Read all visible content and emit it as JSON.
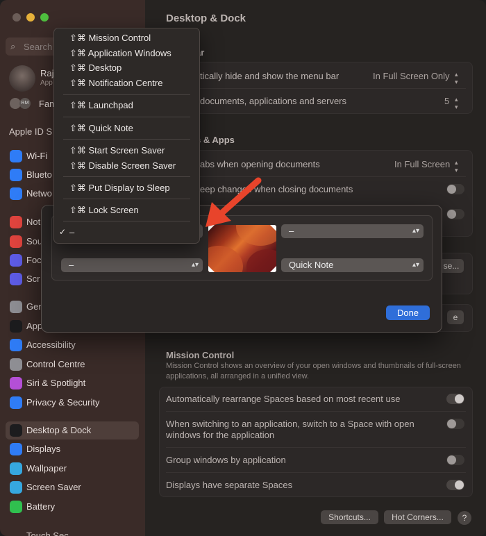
{
  "sidebar": {
    "search_placeholder": "Search",
    "user_name": "Raj",
    "user_sub": "App",
    "family_label": "Fam",
    "family_initials": "RM",
    "apple_id_header": "Apple ID S",
    "items": [
      {
        "label": "Wi-Fi",
        "icon": "wifi-icon",
        "color": "#2f7cf6"
      },
      {
        "label": "Blueto",
        "icon": "bluetooth-icon",
        "color": "#2f7cf6"
      },
      {
        "label": "Netwo",
        "icon": "network-icon",
        "color": "#2f7cf6"
      },
      {
        "label": "Not",
        "icon": "notifications-icon",
        "color": "#e0443e"
      },
      {
        "label": "Sou",
        "icon": "sound-icon",
        "color": "#e0443e"
      },
      {
        "label": "Foc",
        "icon": "focus-icon",
        "color": "#5e5ce6"
      },
      {
        "label": "Scr",
        "icon": "screen-time-icon",
        "color": "#5e5ce6"
      },
      {
        "label": "Gen",
        "icon": "general-icon",
        "color": "#8e8e93"
      },
      {
        "label": "App",
        "icon": "appearance-icon",
        "color": "#1c1c1e"
      },
      {
        "label": "Accessibility",
        "icon": "accessibility-icon",
        "color": "#2f7cf6"
      },
      {
        "label": "Control Centre",
        "icon": "control-centre-icon",
        "color": "#8e8e93"
      },
      {
        "label": "Siri & Spotlight",
        "icon": "siri-icon",
        "color": "#b44fd6"
      },
      {
        "label": "Privacy & Security",
        "icon": "privacy-hand-icon",
        "color": "#2f7cf6"
      },
      {
        "label": "Desktop & Dock",
        "icon": "desktop-dock-icon",
        "color": "#1c1c1e"
      },
      {
        "label": "Displays",
        "icon": "displays-icon",
        "color": "#2f7cf6"
      },
      {
        "label": "Wallpaper",
        "icon": "wallpaper-icon",
        "color": "#36a8e0"
      },
      {
        "label": "Screen Saver",
        "icon": "screen-saver-icon",
        "color": "#36a8e0"
      },
      {
        "label": "Battery",
        "icon": "battery-icon",
        "color": "#30c04f"
      }
    ],
    "bottom_partial": "Touch Sec"
  },
  "main": {
    "title": "Desktop & Dock",
    "menu_bar_header": "ar",
    "rows_top": [
      {
        "label": "tically hide and show the menu bar",
        "value": "In Full Screen Only"
      },
      {
        "label": "documents, applications and servers",
        "value": "5"
      }
    ],
    "windows_header": "s & Apps",
    "rows_windows": [
      {
        "label": "abs when opening documents",
        "value": "In Full Screen"
      },
      {
        "label": "eep changes when closing documents"
      }
    ],
    "partial_buttons": [
      "se...",
      "e"
    ],
    "mission_control": {
      "header": "Mission Control",
      "description": "Mission Control shows an overview of your open windows and thumbnails of full-screen applications, all arranged in a unified view.",
      "rows": [
        "Automatically rearrange Spaces based on most recent use",
        "When switching to an application, switch to a Space with open windows for the application",
        "Group windows by application",
        "Displays have separate Spaces"
      ]
    },
    "buttons": {
      "shortcuts": "Shortcuts...",
      "hot_corners": "Hot Corners...",
      "help": "?"
    }
  },
  "dialog": {
    "top_right": "–",
    "bottom_left": "–",
    "bottom_right": "Quick Note",
    "done": "Done"
  },
  "menu": {
    "items": [
      "⇧⌘ Mission Control",
      "⇧⌘ Application Windows",
      "⇧⌘ Desktop",
      "⇧⌘ Notification Centre",
      "⇧⌘ Launchpad",
      "⇧⌘ Quick Note",
      "⇧⌘ Start Screen Saver",
      "⇧⌘ Disable Screen Saver",
      "⇧⌘ Put Display to Sleep",
      "⇧⌘ Lock Screen",
      "–"
    ],
    "checkmark": "✓",
    "selected_index": 10
  },
  "colors": {
    "accent": "#2f6ed9",
    "annotation_arrow": "#e8442b"
  }
}
